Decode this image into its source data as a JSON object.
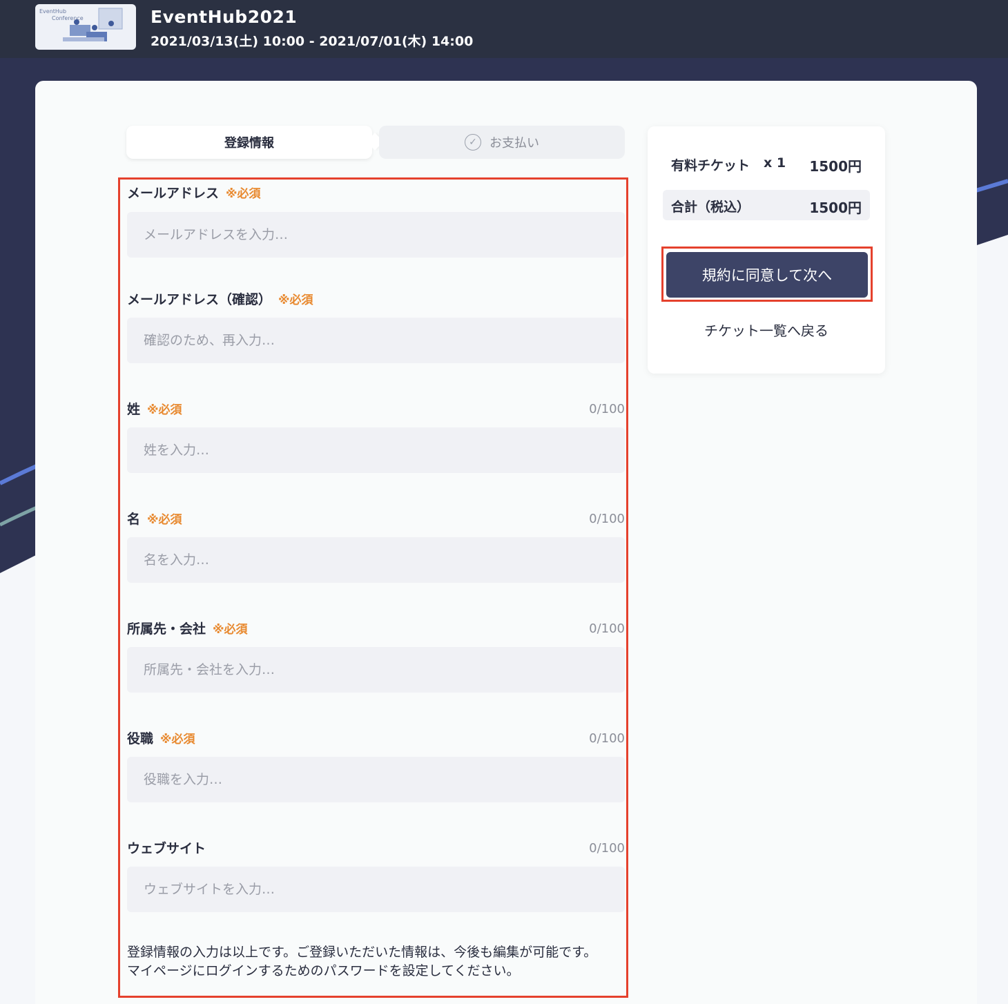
{
  "header": {
    "thumb_text_line1": "EventHub",
    "thumb_text_line2": "Conference",
    "title": "EventHub2021",
    "dates": "2021/03/13(土) 10:00 - 2021/07/01(木) 14:00"
  },
  "steps": {
    "registration": "登録情報",
    "payment": "お支払い"
  },
  "required_label": "※必須",
  "fields": {
    "email": {
      "label": "メールアドレス",
      "placeholder": "メールアドレスを入力…"
    },
    "email_confirm": {
      "label": "メールアドレス（確認）",
      "placeholder": "確認のため、再入力…"
    },
    "last_name": {
      "label": "姓",
      "placeholder": "姓を入力…",
      "counter": "0/100"
    },
    "first_name": {
      "label": "名",
      "placeholder": "名を入力…",
      "counter": "0/100"
    },
    "company": {
      "label": "所属先・会社",
      "placeholder": "所属先・会社を入力…",
      "counter": "0/100"
    },
    "position": {
      "label": "役職",
      "placeholder": "役職を入力…",
      "counter": "0/100"
    },
    "website": {
      "label": "ウェブサイト",
      "placeholder": "ウェブサイトを入力…",
      "counter": "0/100"
    }
  },
  "note": {
    "line1": "登録情報の入力は以上です。ご登録いただいた情報は、今後も編集が可能です。",
    "line2": "マイページにログインするためのパスワードを設定してください。"
  },
  "summary": {
    "ticket_name": "有料チケット",
    "ticket_qty": "x 1",
    "ticket_price": "1500円",
    "total_label": "合計（税込）",
    "total_price": "1500円",
    "agree_button": "規約に同意して次へ",
    "back_link": "チケット一覧へ戻る"
  },
  "colors": {
    "header_bg": "#2b3142",
    "primary_button": "#3d4467",
    "required": "#e8892f",
    "highlight": "#e5412d"
  }
}
